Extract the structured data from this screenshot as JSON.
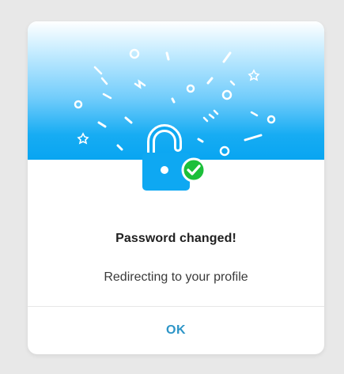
{
  "dialog": {
    "title": "Password changed!",
    "message": "Redirecting to your profile",
    "ok_label": "OK"
  },
  "icons": {
    "illustration": "unlocked-padlock-icon",
    "status": "check-circle-icon"
  },
  "colors": {
    "accent_blue": "#0ea8f2",
    "success_green": "#1cbf3a",
    "ok_text": "#2d95c7",
    "page_background": "#e8e8e8"
  }
}
